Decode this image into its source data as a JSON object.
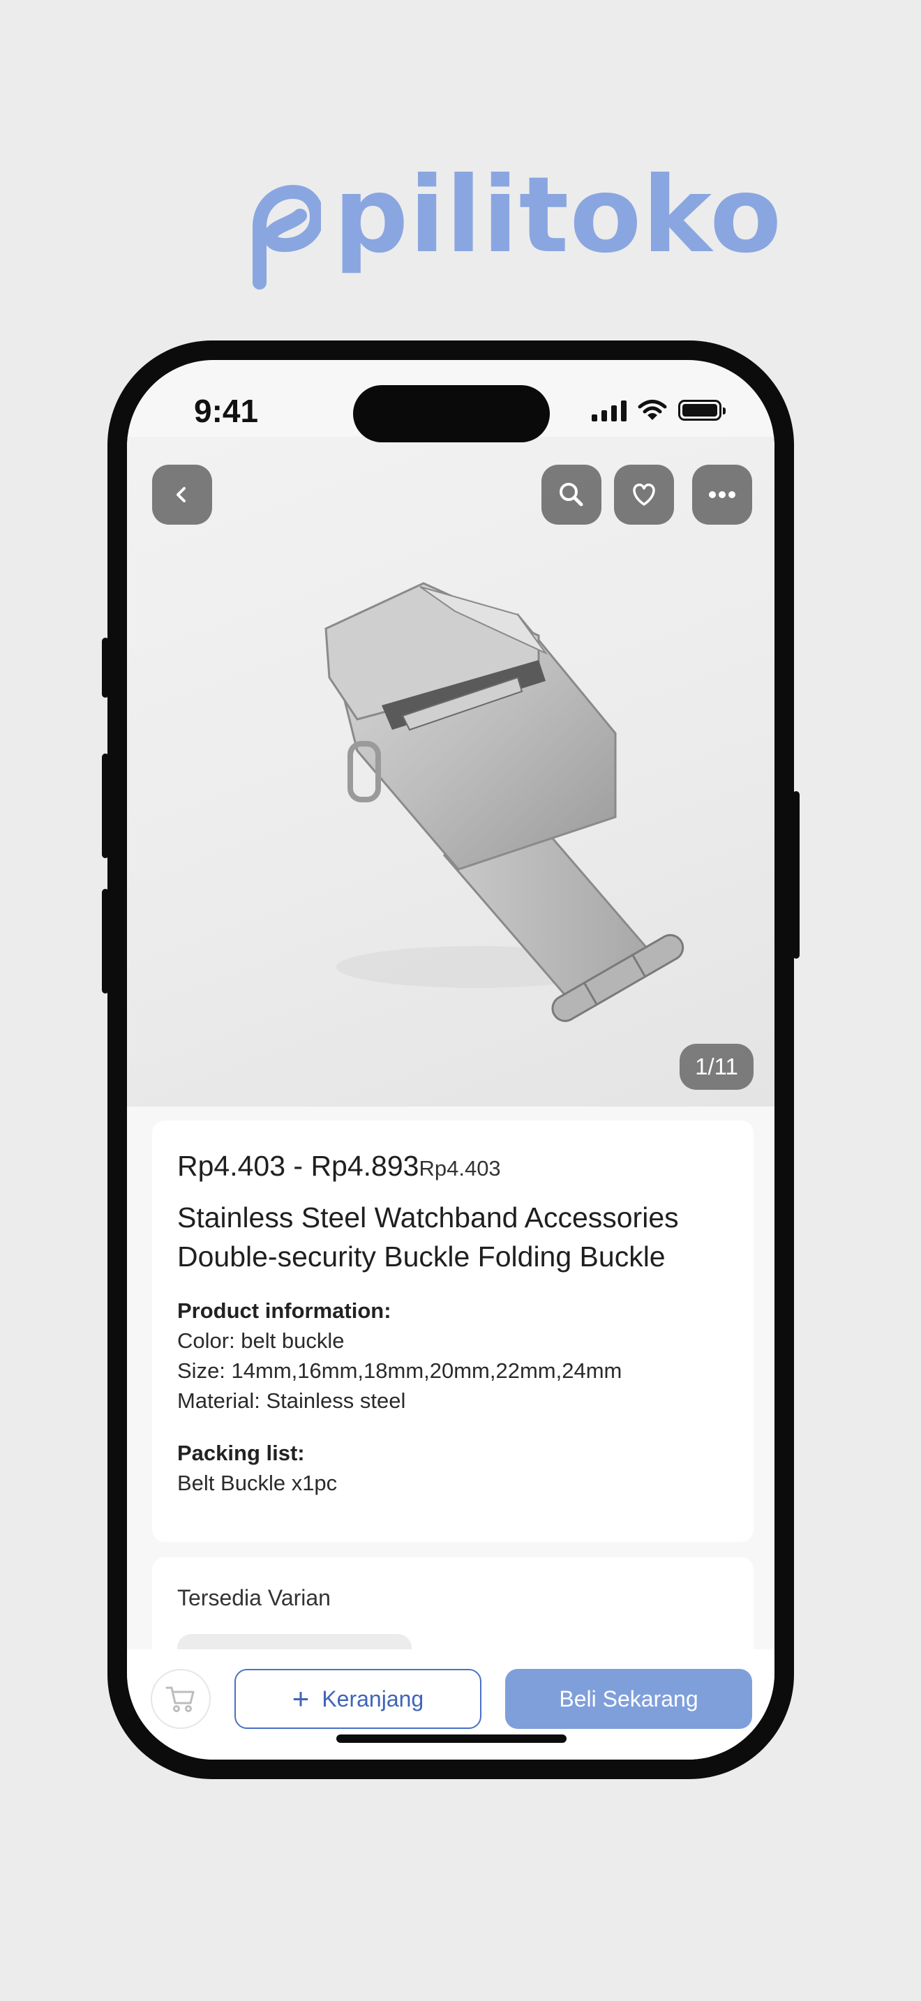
{
  "brand": {
    "name": "pilitoko",
    "color": "#8aa6e0"
  },
  "status_bar": {
    "time": "9:41"
  },
  "gallery": {
    "counter": "1/11"
  },
  "product": {
    "price_range": "Rp4.403 - Rp4.893",
    "original_price": "Rp4.403",
    "title": "Stainless Steel Watchband Accessories Double-security Buckle Folding Buckle",
    "info_heading": "Product information:",
    "color": "Color: belt buckle",
    "size": "Size: 14mm,16mm,18mm,20mm,22mm,24mm",
    "material": "Material: Stainless steel",
    "packing_heading": "Packing list:",
    "packing_item": "Belt Buckle x1pc"
  },
  "variant": {
    "label": "Tersedia Varian"
  },
  "actions": {
    "add_to_cart": "Keranjang",
    "buy_now": "Beli Sekarang",
    "accent": "#4a70c6",
    "buy_color": "#7f9fdb"
  },
  "icons": [
    "back-icon",
    "search-icon",
    "heart-icon",
    "more-icon",
    "cart-icon",
    "plus-icon",
    "signal-icon",
    "wifi-icon",
    "battery-icon"
  ]
}
